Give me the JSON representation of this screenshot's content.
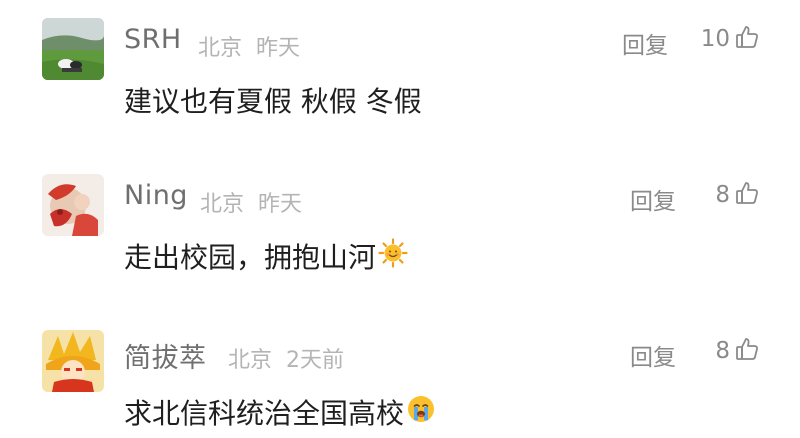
{
  "comments": [
    {
      "user": "SRH",
      "location": "北京",
      "time": "昨天",
      "reply_label": "回复",
      "likes": "10",
      "text": "建议也有夏假 秋假 冬假",
      "emoji": ""
    },
    {
      "user": "Ning",
      "location": "北京",
      "time": "昨天",
      "reply_label": "回复",
      "likes": "8",
      "text": "走出校园，拥抱山河",
      "emoji": "sun-emoji"
    },
    {
      "user": "简拔萃",
      "location": "北京",
      "time": "2天前",
      "reply_label": "回复",
      "likes": "8",
      "text": "求北信科统治全国高校",
      "emoji": "crying-emoji"
    }
  ],
  "icons": {
    "like": "thumbs-up-icon"
  },
  "colors": {
    "username": "#6f6f6f",
    "meta": "#b4b4b4",
    "text": "#1f1f1f",
    "action": "#8a8a8a"
  }
}
